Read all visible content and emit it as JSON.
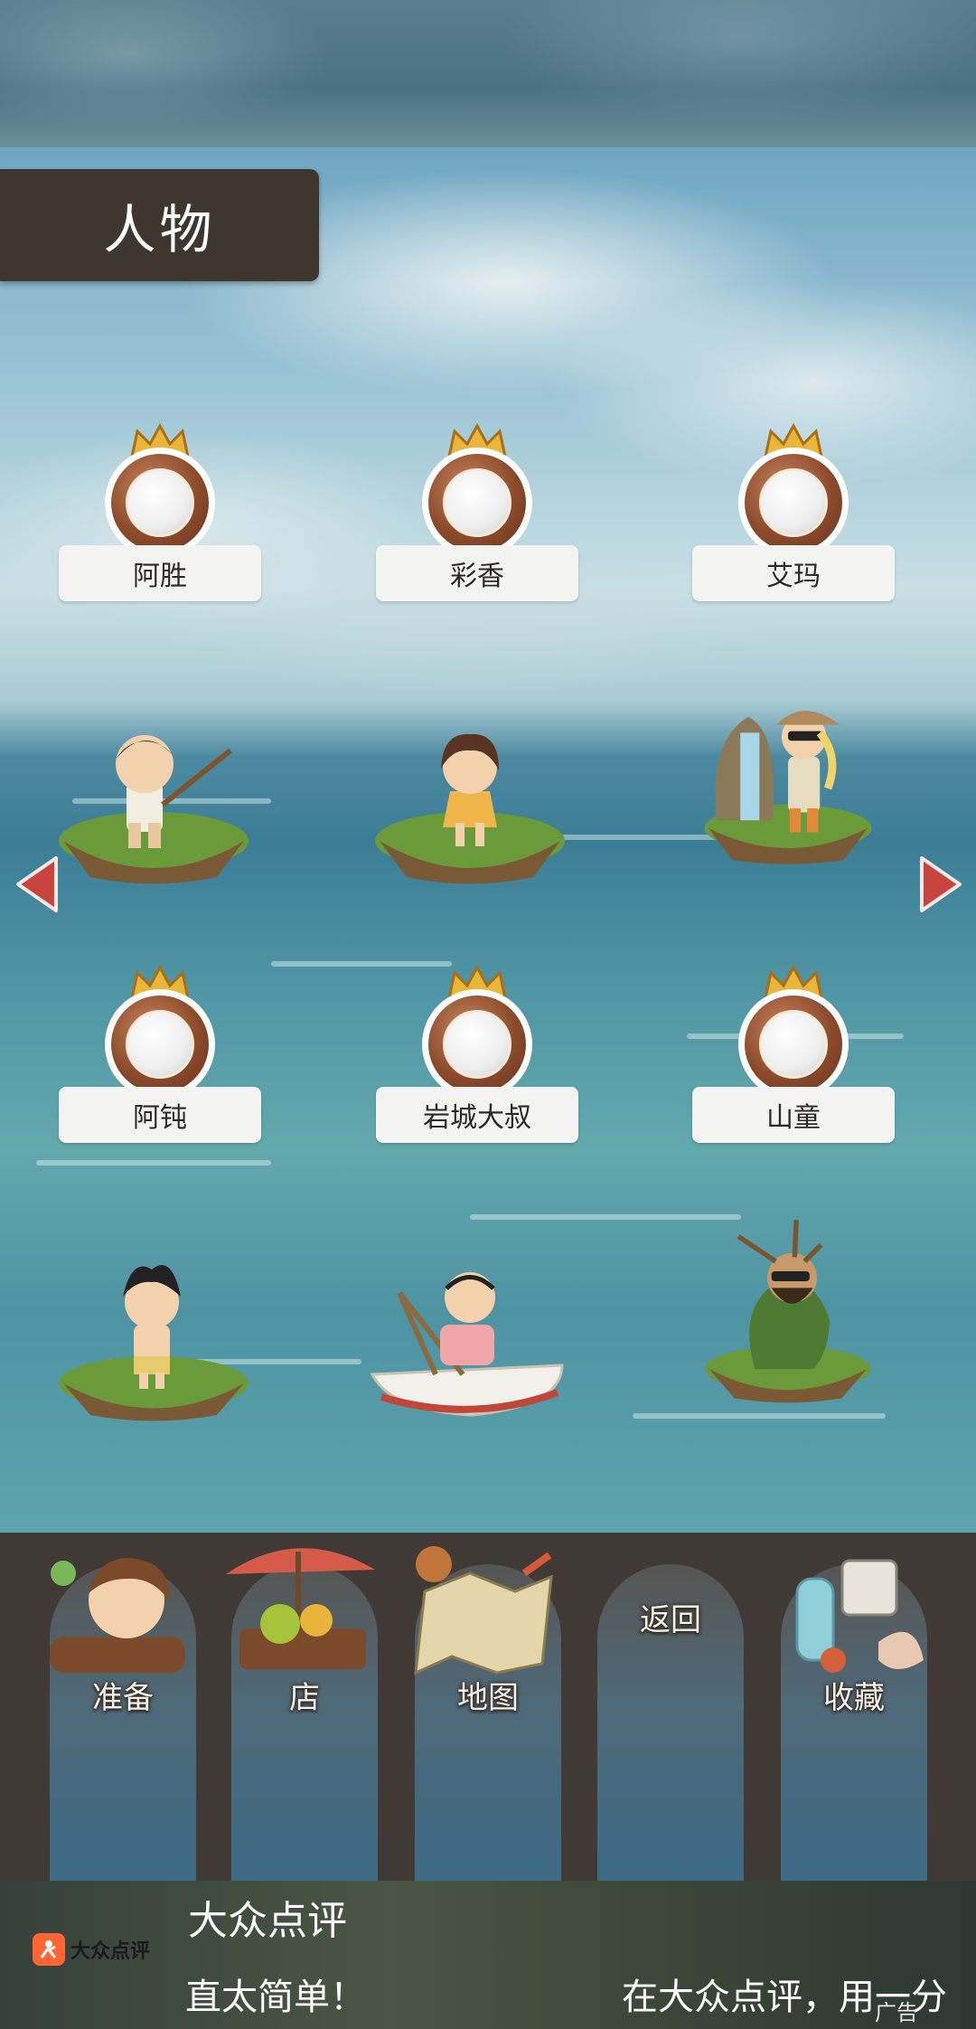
{
  "screen": {
    "title": "人物"
  },
  "characters": [
    {
      "name": "阿胜",
      "medal": "gold-crown"
    },
    {
      "name": "彩香",
      "medal": "gold-crown"
    },
    {
      "name": "艾玛",
      "medal": "gold-crown"
    },
    {
      "name": "阿钝",
      "medal": "gold-crown"
    },
    {
      "name": "岩城大叔",
      "medal": "gold-crown"
    },
    {
      "name": "山童",
      "medal": "gold-crown"
    }
  ],
  "menu": {
    "items": [
      {
        "label": "准备",
        "icon": "adventurer-icon"
      },
      {
        "label": "店",
        "icon": "shop-icon"
      },
      {
        "label": "地图",
        "icon": "map-icon"
      },
      {
        "label": "返回",
        "icon": ""
      },
      {
        "label": "收藏",
        "icon": "collection-icon"
      }
    ]
  },
  "ad": {
    "brand": "大众点评",
    "logo_text": "大众点评",
    "line1": "直太简单！",
    "line2": "在大众点评，用一分",
    "tag": "广告"
  },
  "colors": {
    "title_bg": "#3f3630",
    "menu_bg": "#413935",
    "arrow": "#c8453f",
    "crown": "#e9b53a",
    "medal_bronze": "#8b4a2b"
  }
}
